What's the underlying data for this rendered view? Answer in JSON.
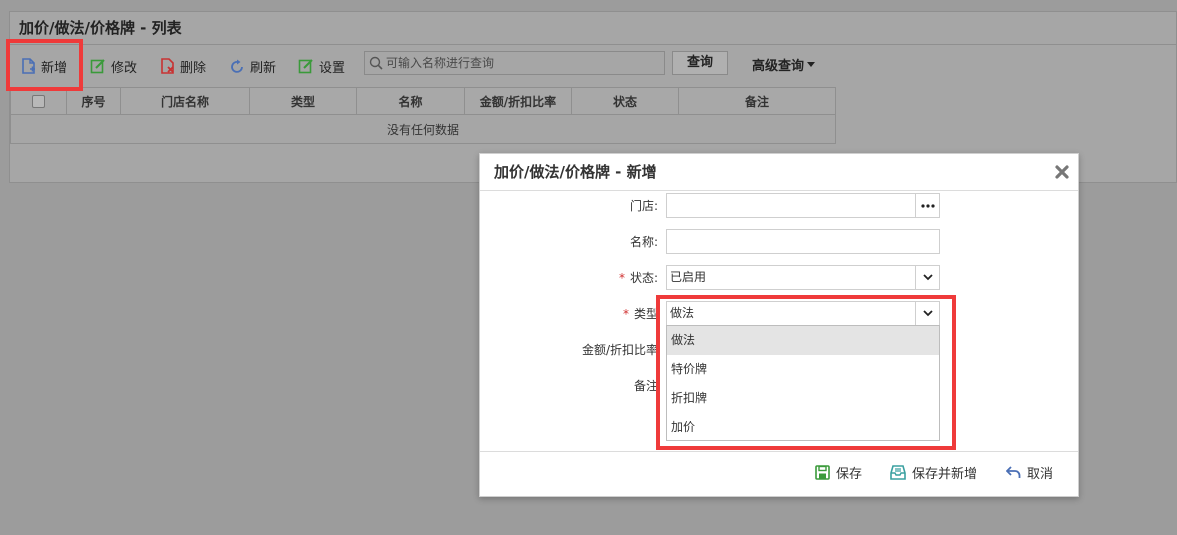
{
  "list": {
    "title": "加价/做法/价格牌 - 列表",
    "toolbar": {
      "add": "新增",
      "edit": "修改",
      "delete": "删除",
      "refresh": "刷新",
      "settings": "设置",
      "search_placeholder": "可输入名称进行查询",
      "query": "查询",
      "advanced": "高级查询"
    },
    "columns": [
      "序号",
      "门店名称",
      "类型",
      "名称",
      "金额/折扣比率",
      "状态",
      "备注"
    ],
    "empty_text": "没有任何数据"
  },
  "modal": {
    "title": "加价/做法/价格牌 - 新增",
    "fields": {
      "store": {
        "label": "门店:",
        "value": ""
      },
      "name": {
        "label": "名称:",
        "value": ""
      },
      "status": {
        "label": "状态:",
        "value": "已启用",
        "required_mark": "*"
      },
      "type": {
        "label": "类型",
        "value": "做法",
        "required_mark": "*"
      },
      "amount": {
        "label": "金额/折扣比率"
      },
      "remark": {
        "label": "备注"
      }
    },
    "type_options": [
      "做法",
      "特价牌",
      "折扣牌",
      "加价"
    ],
    "footer": {
      "save": "保存",
      "save_new": "保存并新增",
      "cancel": "取消"
    }
  },
  "colors": {
    "highlight": "#ef3a3a",
    "icon_blue": "#4a6fb5",
    "icon_green": "#3a9a3a",
    "icon_red": "#c83232"
  }
}
